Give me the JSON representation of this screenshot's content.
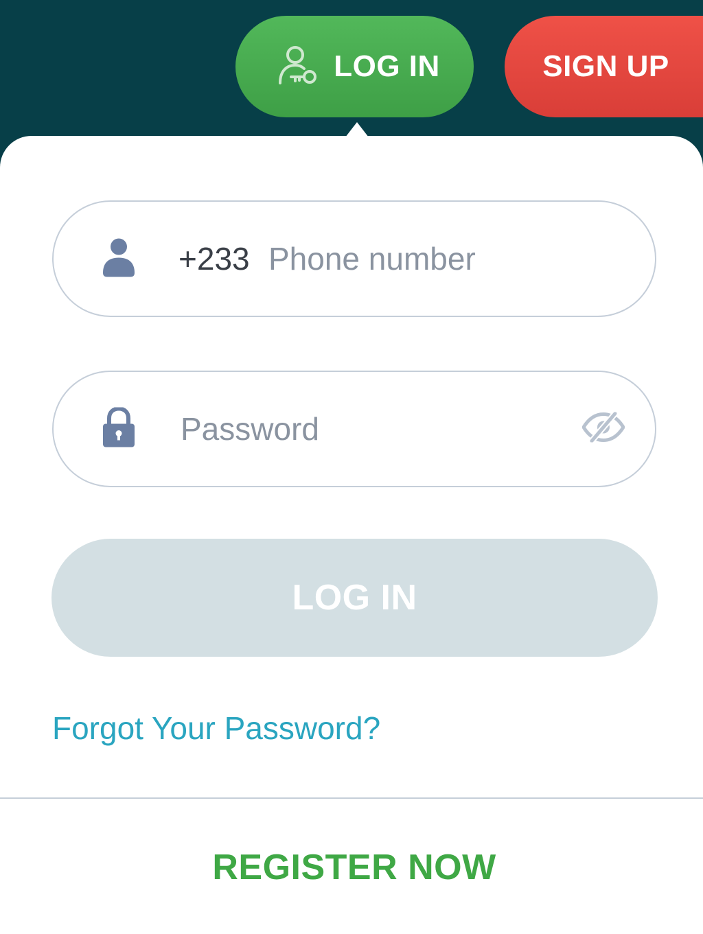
{
  "header": {
    "login_button": {
      "label": "LOG IN",
      "icon": "user-key-icon"
    },
    "signup_button": {
      "label": "SIGN UP"
    }
  },
  "login_form": {
    "phone": {
      "icon": "user-icon",
      "country_code": "+233",
      "placeholder": "Phone number",
      "value": ""
    },
    "password": {
      "icon": "lock-icon",
      "placeholder": "Password",
      "value": "",
      "toggle_icon": "eye-hidden-icon"
    },
    "submit_label": "LOG IN",
    "forgot_link": "Forgot Your Password?",
    "register_link": "REGISTER NOW"
  },
  "colors": {
    "header_bg": "#073f48",
    "login_green": "#4caf50",
    "signup_red": "#e8473f",
    "disabled_button": "#d3dfe3",
    "link_blue": "#2aa5c0",
    "register_green": "#3fa845"
  }
}
